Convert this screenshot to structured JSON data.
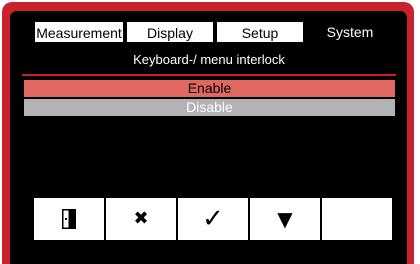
{
  "tabs": [
    {
      "label": "Measurement"
    },
    {
      "label": "Display"
    },
    {
      "label": "Setup"
    },
    {
      "label": "System"
    }
  ],
  "active_tab": "System",
  "menu": {
    "title": "Keyboard-/ menu interlock",
    "options": [
      {
        "label": "Enable",
        "selected": true
      },
      {
        "label": "Disable",
        "selected": false
      }
    ]
  },
  "function_keys": [
    {
      "icon": "exit-door-icon",
      "glyph": "■"
    },
    {
      "icon": "cancel-icon",
      "glyph": "✖"
    },
    {
      "icon": "confirm-check-icon",
      "glyph": "✓"
    },
    {
      "icon": "arrow-down-icon",
      "glyph": "▼"
    },
    {
      "icon": "blank-key",
      "glyph": ""
    }
  ],
  "colors": {
    "frame": "#c8232c",
    "selected_option": "#e06860",
    "unselected_option": "#b3b3b3"
  }
}
